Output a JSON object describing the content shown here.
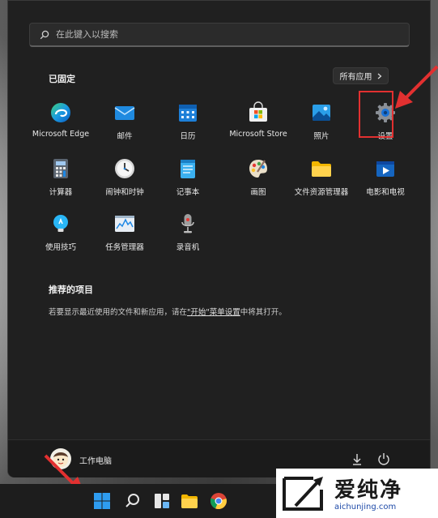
{
  "search": {
    "placeholder": "在此键入以搜索"
  },
  "pinned": {
    "title": "已固定",
    "all_apps_label": "所有应用",
    "apps": [
      {
        "label": "Microsoft Edge",
        "icon": "edge-icon"
      },
      {
        "label": "邮件",
        "icon": "mail-icon"
      },
      {
        "label": "日历",
        "icon": "calendar-icon"
      },
      {
        "label": "Microsoft Store",
        "icon": "store-icon"
      },
      {
        "label": "照片",
        "icon": "photos-icon"
      },
      {
        "label": "设置",
        "icon": "settings-icon"
      },
      {
        "label": "计算器",
        "icon": "calculator-icon"
      },
      {
        "label": "闹钟和时钟",
        "icon": "clock-icon"
      },
      {
        "label": "记事本",
        "icon": "notepad-icon"
      },
      {
        "label": "画图",
        "icon": "paint-icon"
      },
      {
        "label": "文件资源管理器",
        "icon": "folder-icon"
      },
      {
        "label": "电影和电视",
        "icon": "movies-icon"
      },
      {
        "label": "使用技巧",
        "icon": "tips-icon"
      },
      {
        "label": "任务管理器",
        "icon": "task-manager-icon"
      },
      {
        "label": "录音机",
        "icon": "recorder-icon"
      }
    ]
  },
  "recommended": {
    "title": "推荐的项目",
    "text_before": "若要显示最近使用的文件和新应用，请在",
    "link": "\"开始\"菜单设置",
    "text_after": "中将其打开。"
  },
  "user": {
    "name": "工作电脑"
  },
  "watermark": {
    "brand": "爱纯净",
    "url": "aichunjing.com"
  },
  "colors": {
    "highlight": "#e23030",
    "background": "#202020"
  }
}
